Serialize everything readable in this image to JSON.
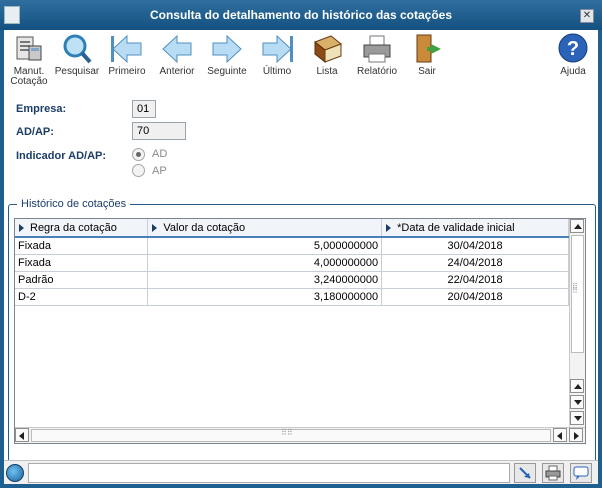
{
  "window": {
    "title": "Consulta do detalhamento do histórico das cotações"
  },
  "toolbar": {
    "manut": "Manut.\nCotação",
    "pesquisar": "Pesquisar",
    "primeiro": "Primeiro",
    "anterior": "Anterior",
    "seguinte": "Seguinte",
    "ultimo": "Último",
    "lista": "Lista",
    "relatorio": "Relatório",
    "sair": "Sair",
    "ajuda": "Ajuda"
  },
  "form": {
    "empresa_label": "Empresa:",
    "empresa_value": "01",
    "adap_label": "AD/AP:",
    "adap_value": "70",
    "indicador_label": "Indicador AD/AP:",
    "options": [
      "AD",
      "AP"
    ],
    "selected": "AD"
  },
  "history": {
    "group_title": "Histórico de cotações",
    "columns": [
      "Regra da cotação",
      "Valor da cotação",
      "*Data de validade inicial"
    ],
    "rows": [
      [
        "Fixada",
        "5,000000000",
        "30/04/2018"
      ],
      [
        "Fixada",
        "4,000000000",
        "24/04/2018"
      ],
      [
        "Padrão",
        "3,240000000",
        "22/04/2018"
      ],
      [
        "D-2",
        "3,180000000",
        "20/04/2018"
      ]
    ]
  },
  "colors": {
    "titlebar": "#1f5f8f",
    "label": "#1b3d68",
    "header_underline": "#4a7fb8"
  }
}
